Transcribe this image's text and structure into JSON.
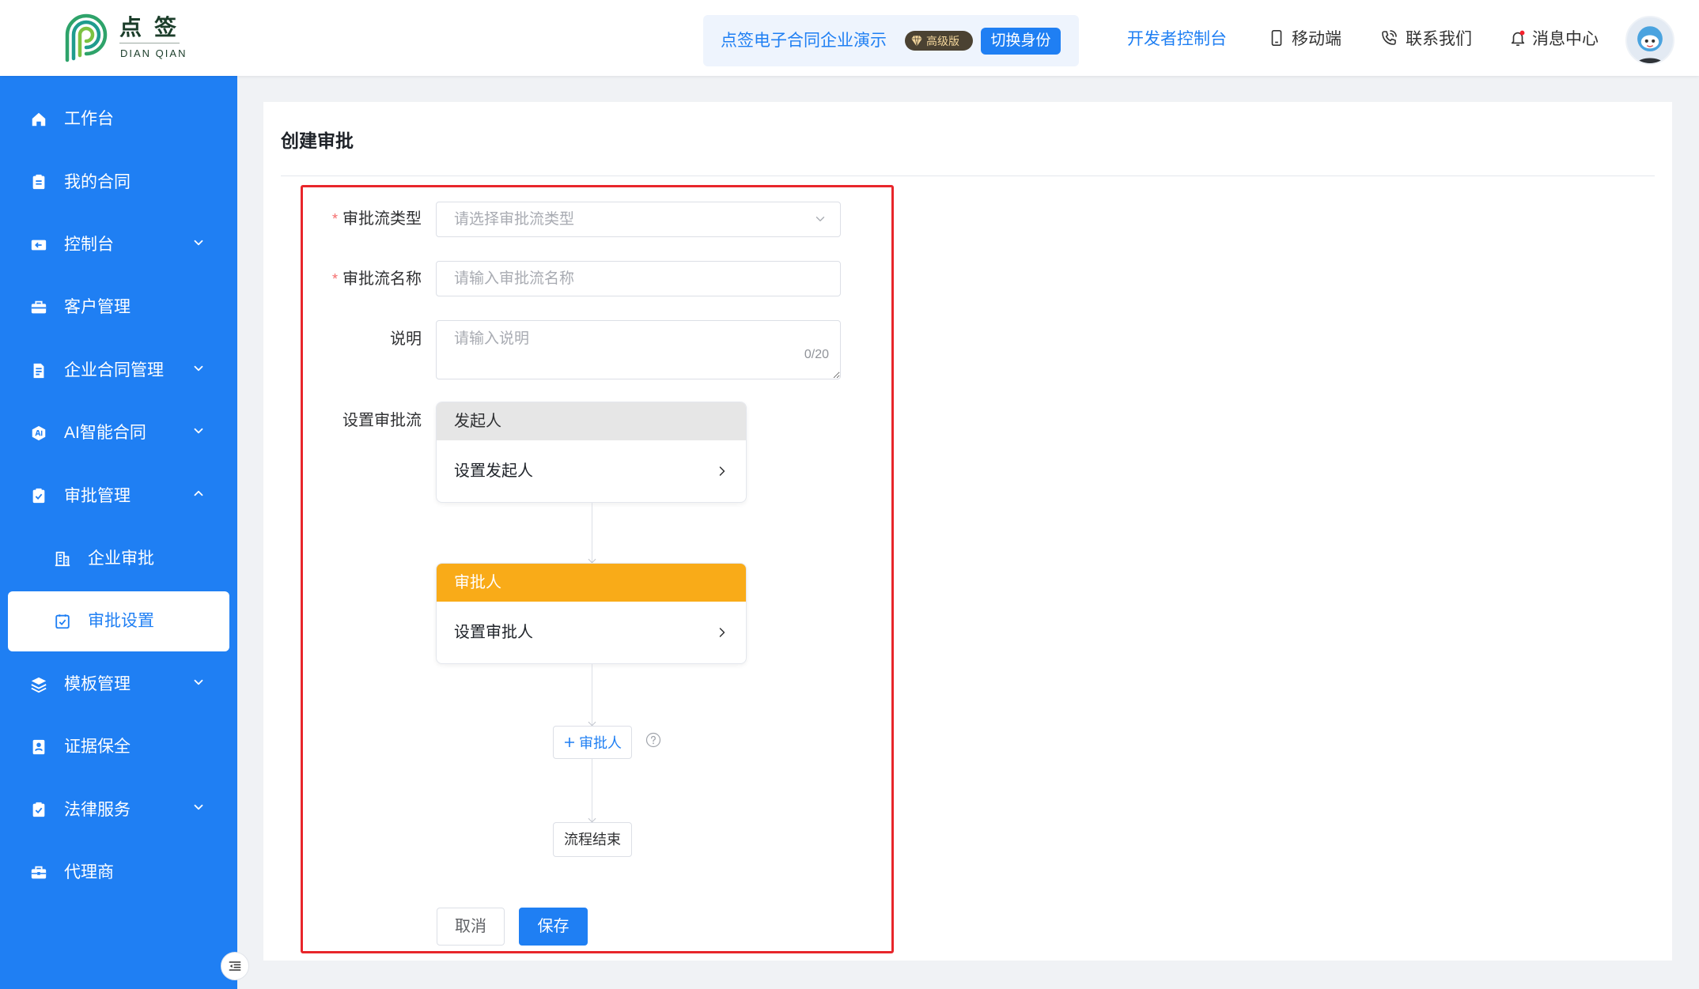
{
  "header": {
    "logo": {
      "name": "点签",
      "subtitle": "DIAN QIAN"
    },
    "org": {
      "name": "点签电子合同企业演示",
      "tier": "高级版",
      "tier_icon": "diamond-icon",
      "switch_label": "切换身份"
    },
    "nav": [
      {
        "label": "开发者控制台"
      },
      {
        "label": "移动端",
        "icon": "mobile-icon"
      },
      {
        "label": "联系我们",
        "icon": "phone-icon"
      },
      {
        "label": "消息中心",
        "icon": "bell-icon",
        "has_unread_dot": true
      }
    ],
    "avatar_icon": "avatar"
  },
  "sidebar": {
    "items": [
      {
        "label": "工作台",
        "icon": "home-icon"
      },
      {
        "label": "我的合同",
        "icon": "clipboard-icon"
      },
      {
        "label": "控制台",
        "icon": "console-icon",
        "expandable": true
      },
      {
        "label": "客户管理",
        "icon": "briefcase-icon"
      },
      {
        "label": "企业合同管理",
        "icon": "document-icon",
        "expandable": true
      },
      {
        "label": "AI智能合同",
        "icon": "ai-icon",
        "expandable": true
      },
      {
        "label": "审批管理",
        "icon": "approval-icon",
        "expandable": true,
        "expanded": true,
        "children": [
          {
            "label": "企业审批",
            "icon": "building-icon"
          },
          {
            "label": "审批设置",
            "icon": "check-square-icon",
            "active": true
          }
        ]
      },
      {
        "label": "模板管理",
        "icon": "layers-icon",
        "expandable": true
      },
      {
        "label": "证据保全",
        "icon": "id-card-icon"
      },
      {
        "label": "法律服务",
        "icon": "legal-icon",
        "expandable": true
      },
      {
        "label": "代理商",
        "icon": "toolbox-icon"
      }
    ],
    "collapse_icon": "menu-fold-icon"
  },
  "page": {
    "title": "创建审批"
  },
  "form": {
    "required_mark": "*",
    "fields": [
      {
        "label": "审批流类型",
        "required": true,
        "placeholder": "请选择审批流类型"
      },
      {
        "label": "审批流名称",
        "required": true,
        "placeholder": "请输入审批流名称",
        "value": ""
      },
      {
        "label": "说明",
        "required": false,
        "placeholder": "请输入说明",
        "value": "",
        "counter": "0/20"
      }
    ],
    "flow_label": "设置审批流"
  },
  "flow": {
    "initiator": {
      "title": "发起人",
      "action": "设置发起人"
    },
    "approver": {
      "title": "审批人",
      "action": "设置审批人"
    },
    "add_approver": "审批人",
    "end": "流程结束"
  },
  "actions": {
    "cancel": "取消",
    "save": "保存"
  },
  "colors": {
    "brand_blue": "#1f7ff3",
    "sidebar_bg": "#1f7ff3",
    "page_bg": "#f0f2f5",
    "approver_header": "#f9ab18",
    "initiator_header": "#e6e6e6",
    "highlight_border": "#e8262b",
    "required_mark": "#f56c6c",
    "unread_dot": "#f5222d"
  }
}
